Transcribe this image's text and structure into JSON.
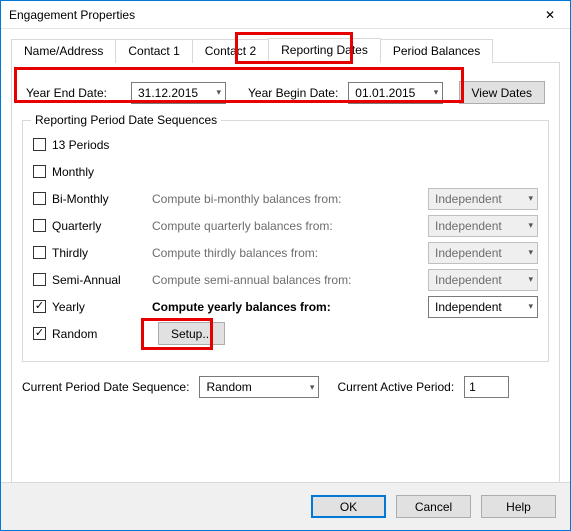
{
  "window": {
    "title": "Engagement Properties",
    "close_glyph": "✕"
  },
  "tabs": {
    "t0": "Name/Address",
    "t1": "Contact 1",
    "t2": "Contact 2",
    "t3": "Reporting Dates",
    "t4": "Period Balances"
  },
  "dates": {
    "year_end_label": "Year End Date:",
    "year_end_value": "31.12.2015",
    "year_begin_label": "Year Begin Date:",
    "year_begin_value": "01.01.2015",
    "view_dates_btn": "View Dates"
  },
  "group": {
    "title": "Reporting Period Date Sequences",
    "rows": [
      {
        "label": "13 Periods",
        "checked": false,
        "compute": "",
        "sel": "",
        "has_sel": false,
        "enabled": true
      },
      {
        "label": "Monthly",
        "checked": false,
        "compute": "",
        "sel": "",
        "has_sel": false,
        "enabled": true
      },
      {
        "label": "Bi-Monthly",
        "checked": false,
        "compute": "Compute bi-monthly balances from:",
        "sel": "Independent",
        "has_sel": true,
        "enabled": false
      },
      {
        "label": "Quarterly",
        "checked": false,
        "compute": "Compute quarterly balances from:",
        "sel": "Independent",
        "has_sel": true,
        "enabled": false
      },
      {
        "label": "Thirdly",
        "checked": false,
        "compute": "Compute thirdly balances from:",
        "sel": "Independent",
        "has_sel": true,
        "enabled": false
      },
      {
        "label": "Semi-Annual",
        "checked": false,
        "compute": "Compute semi-annual balances from:",
        "sel": "Independent",
        "has_sel": true,
        "enabled": false
      },
      {
        "label": "Yearly",
        "checked": true,
        "compute": "Compute yearly balances from:",
        "sel": "Independent",
        "has_sel": true,
        "enabled": true
      },
      {
        "label": "Random",
        "checked": true,
        "compute": "",
        "sel": "",
        "has_sel": false,
        "enabled": true
      }
    ],
    "setup_btn": "Setup..."
  },
  "sequence": {
    "current_seq_label": "Current Period Date Sequence:",
    "current_seq_value": "Random",
    "active_period_label": "Current Active Period:",
    "active_period_value": "1"
  },
  "footer": {
    "ok": "OK",
    "cancel": "Cancel",
    "help": "Help"
  }
}
